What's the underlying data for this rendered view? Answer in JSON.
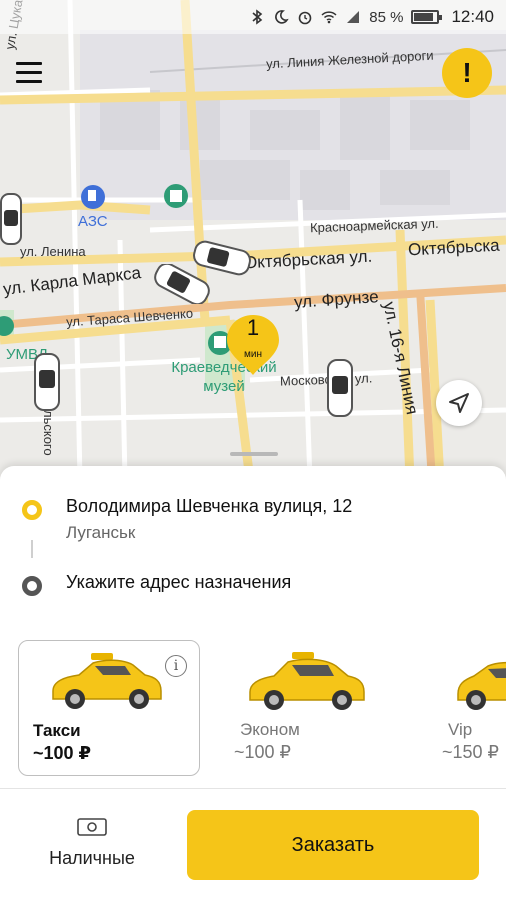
{
  "status_bar": {
    "icons": [
      "bluetooth-icon",
      "moon-icon",
      "alarm-icon",
      "wifi-icon",
      "signal-icon"
    ],
    "battery": "85 %",
    "battery_level": 0.85,
    "time": "12:40"
  },
  "map": {
    "streets": [
      "ул. Цуката",
      "ул. Линия Железной дороги",
      "АЗС",
      "Красноармейская ул.",
      "ул. Ленина",
      "Октябрьская ул.",
      "Октябрьска",
      "ул. Карла Маркса",
      "ул. Фрунзе",
      "ул. Тараса Шевченко",
      "ул. 16-я Линия",
      "УМВД",
      "Московская ул.",
      "льского"
    ],
    "poi": {
      "museum": "Краеведческий музей"
    },
    "pin": {
      "value": "1",
      "unit": "мин"
    },
    "colors": {
      "accent": "#f5c518",
      "poi_green": "#2e9c76",
      "poi_blue": "#3f6fd8"
    }
  },
  "route": {
    "origin": {
      "address": "Володимира Шевченка вулиця, 12",
      "city": "Луганськ"
    },
    "destination": {
      "placeholder": "Укажите адрес назначения"
    }
  },
  "tariffs": [
    {
      "name": "Такси",
      "price": "~100 ₽",
      "selected": true
    },
    {
      "name": "Эконом",
      "price": "~100 ₽",
      "selected": false
    },
    {
      "name": "Vip",
      "price": "~150 ₽",
      "selected": false
    }
  ],
  "payment": {
    "label": "Наличные",
    "icon": "cash-icon"
  },
  "order_button": {
    "label": "Заказать"
  }
}
